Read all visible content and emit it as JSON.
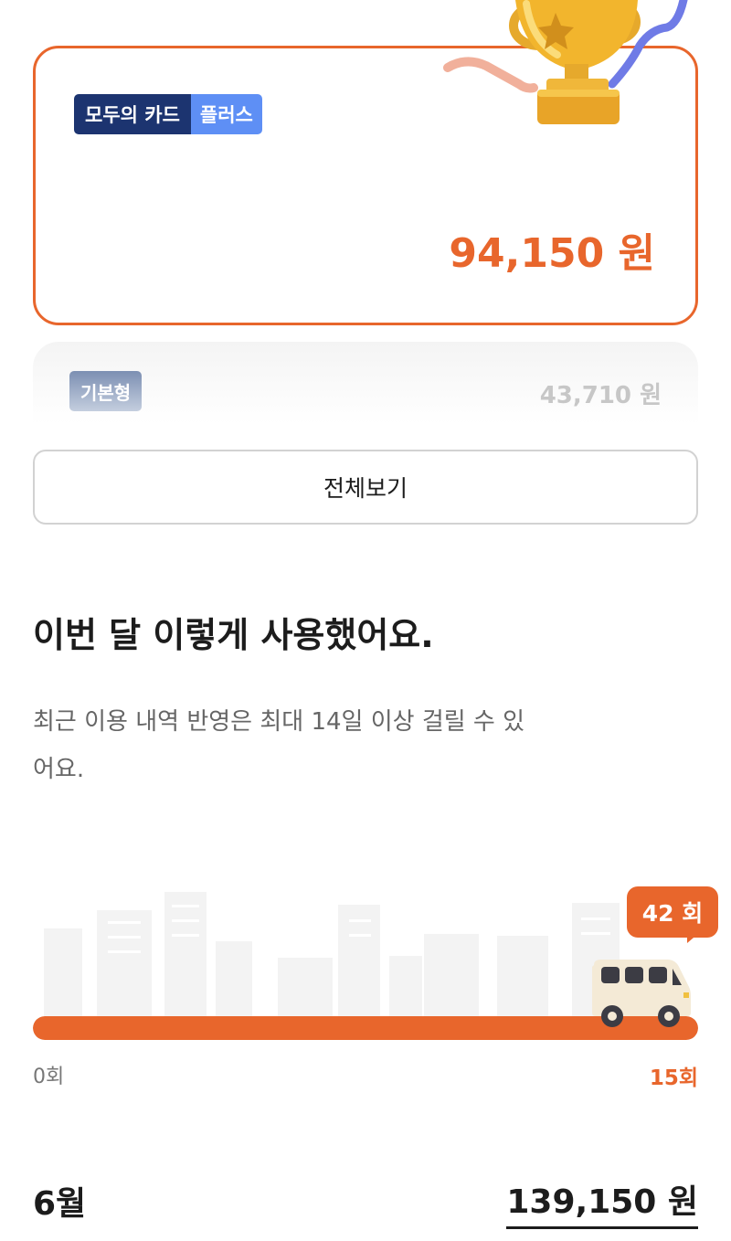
{
  "plus_card": {
    "badge_primary": "모두의 카드",
    "badge_secondary": "플러스",
    "amount": "94,150 원"
  },
  "basic_card": {
    "badge": "기본형",
    "amount": "43,710 원"
  },
  "view_all_label": "전체보기",
  "usage": {
    "title": "이번 달 이렇게 사용했어요.",
    "description": "최근 이용 내역 반영은 최대 14일 이상 걸릴 수 있어요.",
    "count_badge": "42 회",
    "scale_min": "0회",
    "scale_max": "15회",
    "progress_fraction": 1.0
  },
  "monthly": {
    "month": "6월",
    "total": "139,150 원"
  },
  "colors": {
    "accent": "#e8662c",
    "badge_dark": "#1c3470",
    "badge_light": "#5e8ff5"
  },
  "icons": {
    "trophy": "trophy-icon",
    "van": "van-icon",
    "city": "city-skyline-illustration"
  }
}
